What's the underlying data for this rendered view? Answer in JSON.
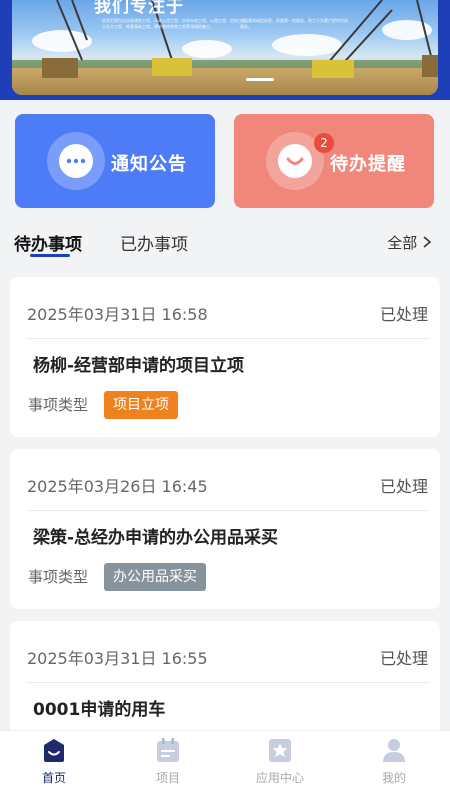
{
  "banner": {
    "title": "我们专注于",
    "text_left": "经营范围包括房屋建筑工程、市政公用工程、水利水电工程、公路工程、机电工程、土石方工程、地基基础工程、建筑装修装饰工程等领域的施工。",
    "text_right": "公司秉承诚信经营、质量第一的理念，致力于为客户提供优质服务。"
  },
  "quick_actions": {
    "notice_label": "通知公告",
    "remind_label": "待办提醒",
    "remind_badge": "2",
    "notice_color": "#4e7cf7",
    "remind_color": "#f1877a"
  },
  "tabs": {
    "active": "待办事项",
    "inactive": "已办事项",
    "all": "全部"
  },
  "items": [
    {
      "time": "2025年03月31日 16:58",
      "status": "已处理",
      "title": "杨柳-经营部申请的项目立项",
      "type_label": "事项类型",
      "tag": "项目立项",
      "tag_color": "#f0821e"
    },
    {
      "time": "2025年03月26日 16:45",
      "status": "已处理",
      "title": "梁策-总经办申请的办公用品采买",
      "type_label": "事项类型",
      "tag": "办公用品采买",
      "tag_color": "#87939c"
    },
    {
      "time": "2025年03月31日 16:55",
      "status": "已处理",
      "title": "0001申请的用车"
    }
  ],
  "tabbar": {
    "home": "首页",
    "project": "项目",
    "apps": "应用中心",
    "mine": "我的",
    "active_color": "#1f2a6b",
    "inactive_color": "#aaaaaa"
  }
}
